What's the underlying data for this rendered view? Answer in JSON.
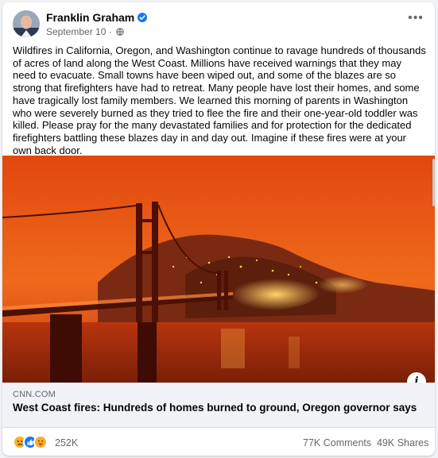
{
  "post": {
    "author": "Franklin Graham",
    "date": "September 10",
    "separator": "·",
    "more_label": "•••",
    "text": "Wildfires in California, Oregon, and Washington continue to ravage hundreds of thousands of acres of land along the West Coast. Millions have received warnings that they may need to evacuate. Small towns have been wiped out, and some of the blazes are so strong that firefighters have had to retreat. Many people have lost their homes, and some have tragically lost family members. We learned this morning of parents in Washington who were severely burned as they tried to flee the fire and their one-year-old toddler was killed. Please pray for the many devastated families and for protection for the dedicated firefighters battling these blazes day in and day out. Imagine if these fires were at your own back door.",
    "icons": {
      "verified": "verified-badge-icon",
      "audience": "globe-icon",
      "more": "more-options-icon",
      "info": "info-icon"
    }
  },
  "link": {
    "domain": "CNN.COM",
    "headline": "West Coast fires: Hundreds of homes burned to ground, Oregon governor says",
    "info_label": "i"
  },
  "engagement": {
    "reactions_count": "252K",
    "comments": "77K Comments",
    "shares": "49K Shares",
    "reaction_icons": [
      "sad-reaction-icon",
      "like-reaction-icon",
      "care-reaction-icon"
    ]
  },
  "colors": {
    "brand_blue": "#1877f2",
    "muted_text": "#65676b",
    "fire_orange": "#e0480e"
  }
}
